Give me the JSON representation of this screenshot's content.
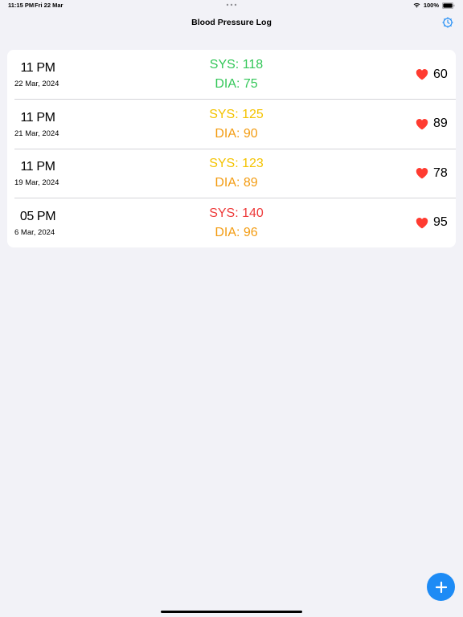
{
  "status_bar": {
    "time": "11:15 PM",
    "date": "Fri 22 Mar",
    "battery": "100%"
  },
  "nav": {
    "title": "Blood Pressure Log"
  },
  "colors": {
    "normal": "#34c759",
    "elevated": "#f4c300",
    "stage1": "#f39c12",
    "stage2": "#ee3b3b",
    "heart": "#ff3b30",
    "accent": "#1d8bf5"
  },
  "entries": [
    {
      "time": "11 PM",
      "date": "22 Mar, 2024",
      "sys": "SYS: 118",
      "dia": "DIA: 75",
      "sys_color": "#34c759",
      "dia_color": "#34c759",
      "pulse": "60"
    },
    {
      "time": "11 PM",
      "date": "21 Mar, 2024",
      "sys": "SYS: 125",
      "dia": "DIA: 90",
      "sys_color": "#f4c300",
      "dia_color": "#f39c12",
      "pulse": "89"
    },
    {
      "time": "11 PM",
      "date": "19 Mar, 2024",
      "sys": "SYS: 123",
      "dia": "DIA: 89",
      "sys_color": "#f4c300",
      "dia_color": "#f39c12",
      "pulse": "78"
    },
    {
      "time": "05 PM",
      "date": "6 Mar, 2024",
      "sys": "SYS: 140",
      "dia": "DIA: 96",
      "sys_color": "#ee3b3b",
      "dia_color": "#f39c12",
      "pulse": "95"
    }
  ],
  "icons": {
    "settings": "gear-clock-icon",
    "pulse": "heart-icon",
    "add": "plus-icon",
    "wifi": "wifi-icon",
    "battery": "battery-icon"
  }
}
